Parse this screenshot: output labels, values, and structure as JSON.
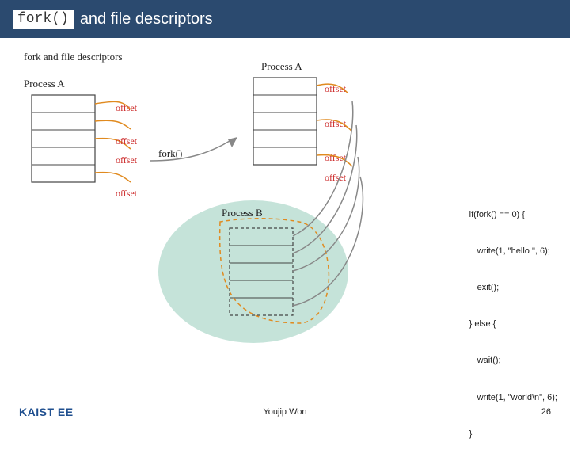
{
  "header": {
    "code_token": "fork()",
    "title": "and file descriptors"
  },
  "diagram": {
    "top_text": "fork and file descriptors",
    "procA": "Process A",
    "procA2": "Process A",
    "procB": "Process B",
    "fork_lbl": "fork()",
    "offset": "offset"
  },
  "code": {
    "l1": "if(fork() == 0) {",
    "l2": "write(1, \"hello \", 6);",
    "l3": "exit();",
    "l4": "} else {",
    "l5": "wait();",
    "l6": "write(1, \"world\\n\", 6);",
    "l7": "}"
  },
  "footer": {
    "logo": "KAIST EE",
    "author": "Youjip Won",
    "page": "26"
  }
}
